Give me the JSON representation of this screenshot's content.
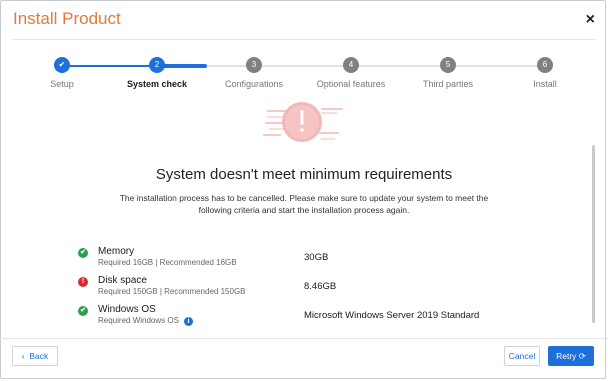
{
  "dialog": {
    "title": "Install Product",
    "close_icon": "close-icon"
  },
  "stepper": {
    "steps": [
      {
        "index": "",
        "label": "Setup",
        "state": "done"
      },
      {
        "index": "2",
        "label": "System check",
        "state": "active"
      },
      {
        "index": "3",
        "label": "Configurations",
        "state": "todo"
      },
      {
        "index": "4",
        "label": "Optional features",
        "state": "todo"
      },
      {
        "index": "5",
        "label": "Third parties",
        "state": "todo"
      },
      {
        "index": "6",
        "label": "Install",
        "state": "todo"
      }
    ]
  },
  "main": {
    "heading": "System doesn't meet minimum requirements",
    "description": "The installation process has to be cancelled. Please make sure to update your system to meet the following criteria and start the installation process again.",
    "requirements": [
      {
        "name": "Memory",
        "detail": "Required 16GB | Recommended 16GB",
        "value": "30GB",
        "status": "ok"
      },
      {
        "name": "Disk space",
        "detail": "Required 150GB | Recommended 150GB",
        "value": "8.46GB",
        "status": "error"
      },
      {
        "name": "Windows OS",
        "detail": "Required Windows OS",
        "value": "Microsoft Windows Server 2019 Standard",
        "status": "ok"
      }
    ]
  },
  "footer": {
    "back_label": "Back",
    "cancel_label": "Cancel",
    "retry_label": "Retry"
  },
  "colors": {
    "accent": "#1e6fd9",
    "title": "#e07a3a",
    "ok": "#2e9e4f",
    "error": "#d92b2b"
  }
}
